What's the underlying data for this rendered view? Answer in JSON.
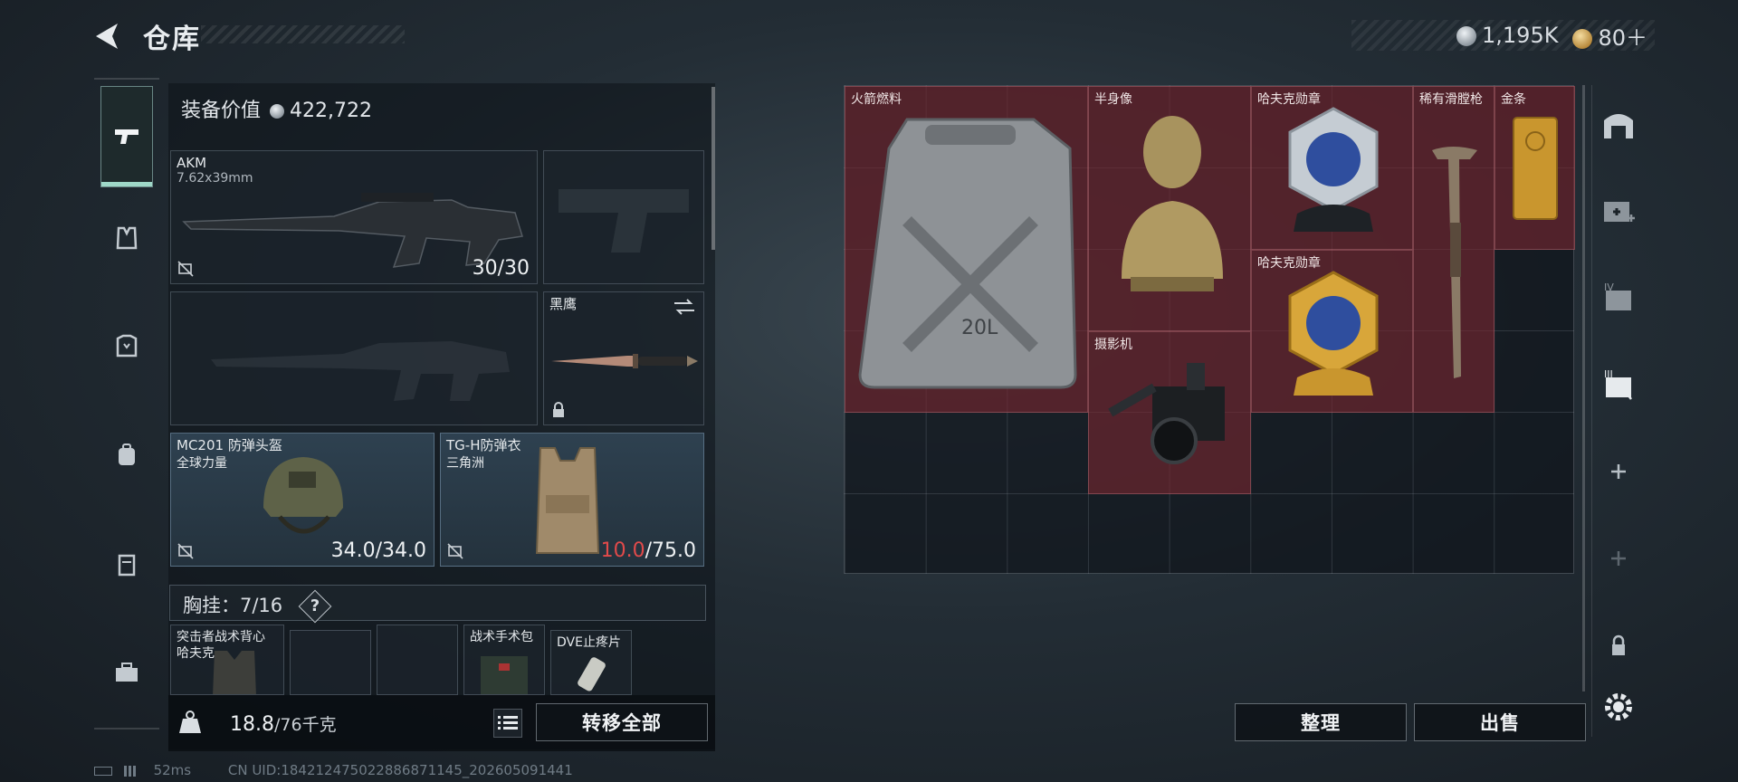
{
  "header": {
    "title": "仓库",
    "currency_silver": "1,195K",
    "currency_gold": "80＋"
  },
  "equipment": {
    "value_label": "装备价值",
    "value": "422,722",
    "primary_weapon": {
      "name": "AKM",
      "caliber": "7.62x39mm",
      "ammo": "30/30"
    },
    "melee": {
      "name": "黑鹰"
    },
    "helmet": {
      "name": "MC201 防弹头盔",
      "maker": "全球力量",
      "durability_current": "34.0",
      "durability_max": "/34.0"
    },
    "armor": {
      "name": "TG-H防弹衣",
      "maker": "三角洲",
      "durability_current": "10.0",
      "durability_max": "/75.0"
    },
    "chest_rig": {
      "label": "胸挂：",
      "capacity": "7/16",
      "help": "?"
    },
    "chest_items": [
      {
        "name": "突击者战术背心",
        "maker": "哈夫克"
      },
      {
        "name": "战术手术包"
      },
      {
        "name": "DVE止疼片"
      }
    ],
    "weight_current": "18.8",
    "weight_max": "/76千克",
    "transfer_all_label": "转移全部"
  },
  "storage": {
    "items": [
      {
        "name": "火箭燃料",
        "icon": "fuel-can"
      },
      {
        "name": "半身像",
        "icon": "bust"
      },
      {
        "name": "哈夫克勋章",
        "icon": "medal-silver"
      },
      {
        "name": "稀有滑膛枪",
        "icon": "musket"
      },
      {
        "name": "金条",
        "icon": "gold-bar"
      },
      {
        "name": "哈夫克勋章",
        "icon": "medal-gold"
      },
      {
        "name": "摄影机",
        "icon": "camera"
      }
    ],
    "sort_label": "整理",
    "sell_label": "出售"
  },
  "status": {
    "ping": "52ms",
    "uid": "CN UID:184212475022886871145_202605091441"
  },
  "colors": {
    "accent": "#9fd8c8",
    "item_bg": "#7a2630",
    "low": "#e14a4a"
  }
}
